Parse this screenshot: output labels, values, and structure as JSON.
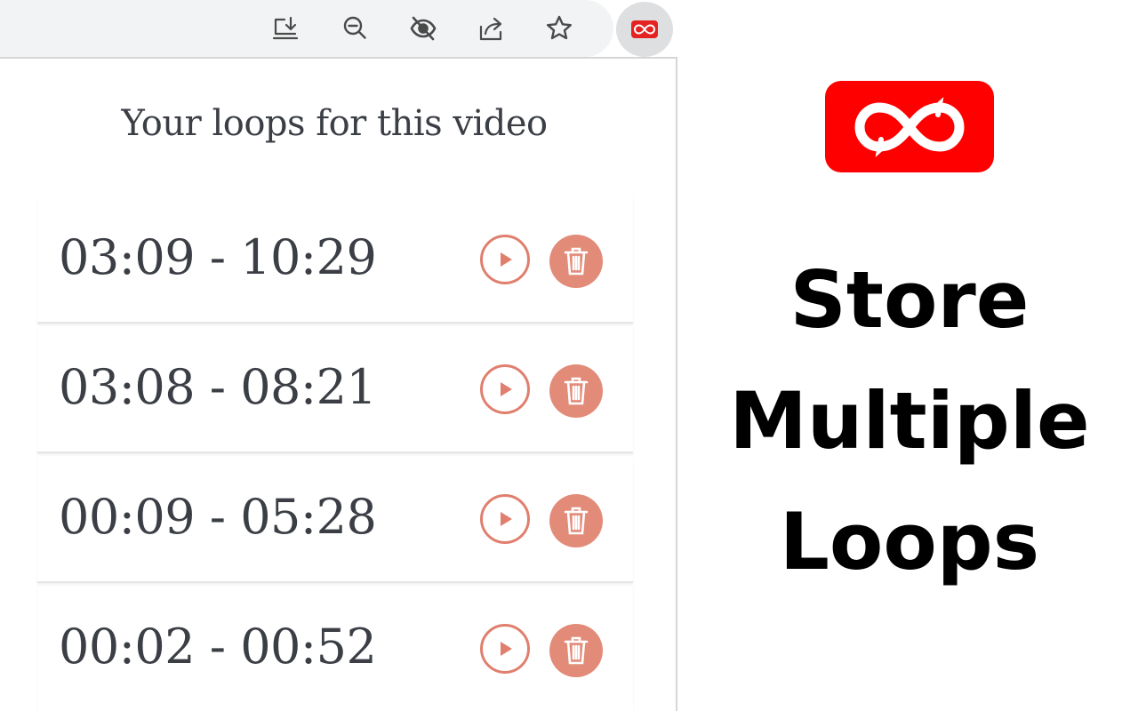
{
  "toolbar": {
    "icons": [
      "install-app-icon",
      "zoom-out-icon",
      "hide-eye-icon",
      "share-icon",
      "bookmark-star-icon"
    ],
    "extension_icon": "infinity-loop-icon"
  },
  "popup": {
    "title": "Your loops for this video",
    "loops": [
      {
        "range": "03:09 - 10:29"
      },
      {
        "range": "03:08 - 08:21"
      },
      {
        "range": "00:09 - 05:28"
      },
      {
        "range": "00:02 - 00:52"
      }
    ]
  },
  "promo": {
    "logo_icon": "infinity-loop-logo",
    "line1": "Store",
    "line2": "Multiple",
    "line3": "Loops"
  },
  "colors": {
    "brand_red": "#ff0000",
    "action_salmon": "#e38b79",
    "text_dark": "#3b3f45"
  }
}
